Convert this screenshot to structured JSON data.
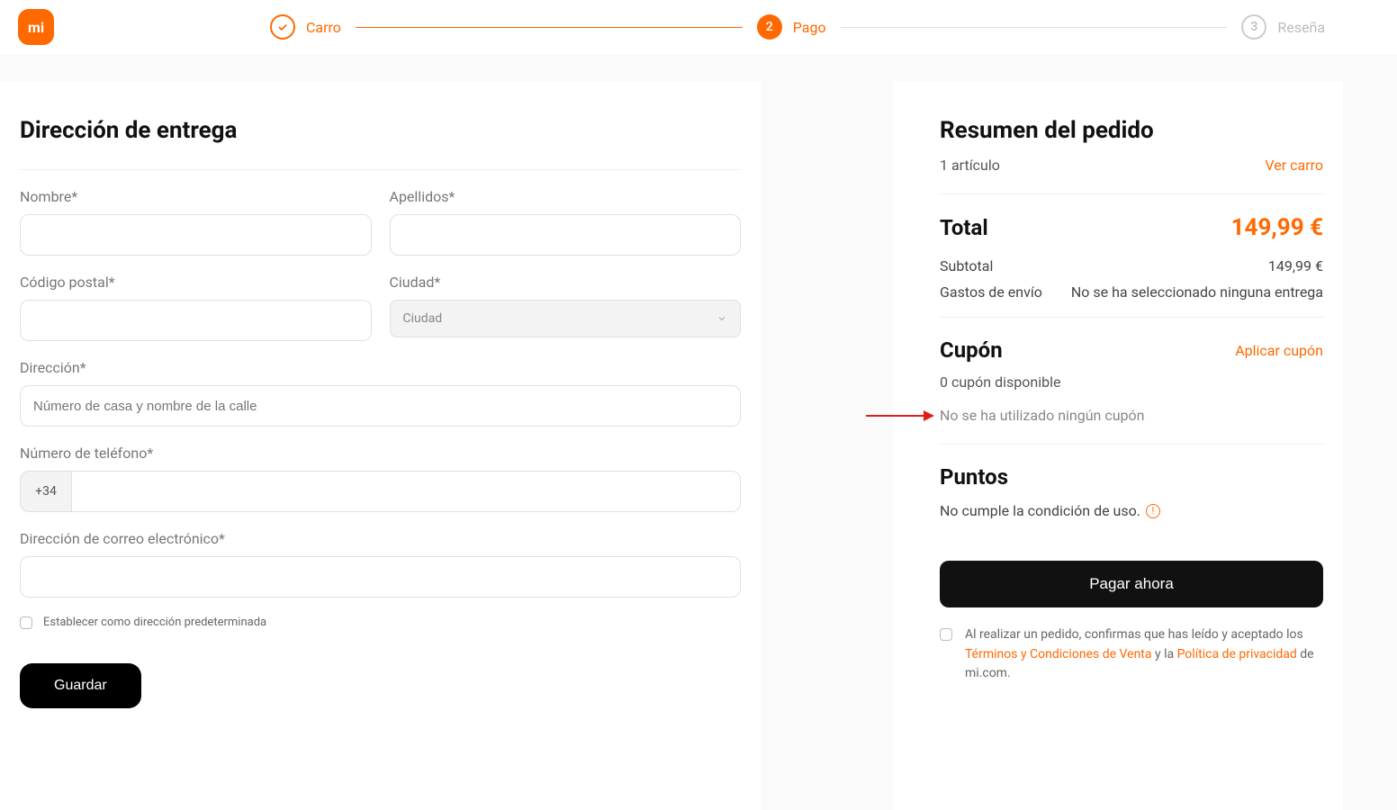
{
  "logo_text": "mi",
  "steps": {
    "s1": {
      "label": "Carro"
    },
    "s2": {
      "num": "2",
      "label": "Pago"
    },
    "s3": {
      "num": "3",
      "label": "Reseña"
    }
  },
  "form": {
    "title": "Dirección de entrega",
    "first_name_label": "Nombre*",
    "last_name_label": "Apellidos*",
    "postal_label": "Código postal*",
    "city_label": "Ciudad*",
    "city_placeholder": "Ciudad",
    "address_label": "Dirección*",
    "address_placeholder": "Número de casa y nombre de la calle",
    "phone_label": "Número de teléfono*",
    "phone_prefix": "+34",
    "email_label": "Dirección de correo electrónico*",
    "default_checkbox": "Establecer como dirección predeterminada",
    "save_btn": "Guardar"
  },
  "summary": {
    "title": "Resumen del pedido",
    "items_text": "1 artículo",
    "view_cart": "Ver carro",
    "total_label": "Total",
    "total_value": "149,99 €",
    "subtotal_label": "Subtotal",
    "subtotal_value": "149,99 €",
    "shipping_label": "Gastos de envío",
    "shipping_value": "No se ha seleccionado ninguna entrega",
    "coupon_title": "Cupón",
    "apply_coupon": "Aplicar cupón",
    "coupon_available": "0 cupón disponible",
    "coupon_none": "No se ha utilizado ningún cupón",
    "points_title": "Puntos",
    "points_note": "No cumple la condición de uso.",
    "pay_now": "Pagar ahora",
    "terms_pre": "Al realizar un pedido, confirmas que has leído y aceptado los ",
    "terms_link1": "Términos y Condiciones de Venta",
    "terms_mid": " y la ",
    "terms_link2": "Política de privacidad",
    "terms_post": " de mi.com."
  }
}
